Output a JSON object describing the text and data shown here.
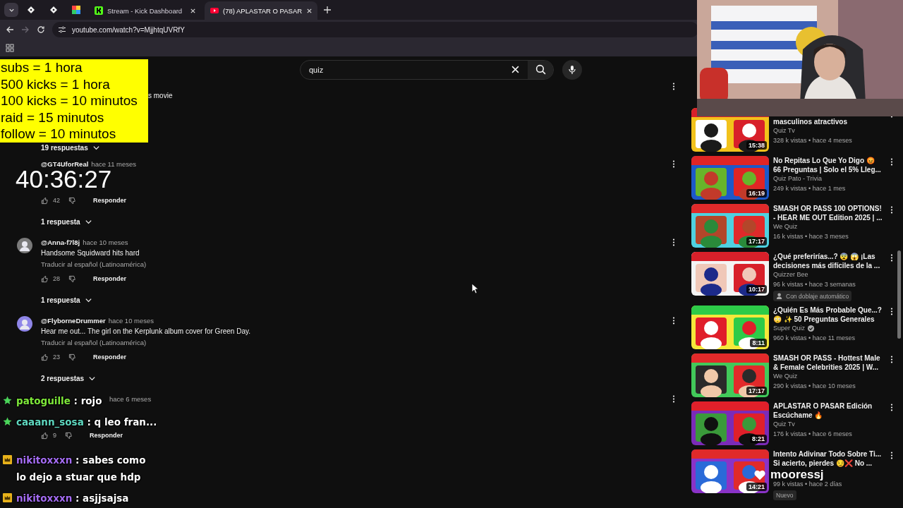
{
  "browser": {
    "tabs": [
      {
        "label": "Stream - Kick Dashboard",
        "kind": "kick",
        "selected": false
      },
      {
        "label": "(78) APLASTAR O PASAR",
        "kind": "youtube",
        "selected": true
      }
    ],
    "address": "youtube.com/watch?v=MjjhtqUVRfY"
  },
  "search": {
    "value": "quiz"
  },
  "comments": [
    {
      "kind": "partial",
      "text": "s movie",
      "replies": "19 respuestas"
    },
    {
      "kind": "full",
      "author": "@GT4UforReal",
      "time": "hace 11 meses",
      "avatar": false,
      "likes": "42",
      "reply": "Responder",
      "replies": "1 respuesta"
    },
    {
      "kind": "full",
      "author": "@Anna-f7l8j",
      "time": "hace 10 meses",
      "avatar": true,
      "text": "Handsome Squidward hits hard",
      "translate": "Traducir al español (Latinoamérica)",
      "likes": "28",
      "reply": "Responder",
      "replies": "1 respuesta"
    },
    {
      "kind": "full",
      "author": "@FlyborneDrummer",
      "time": "hace 10 meses",
      "avatar": true,
      "text": "Hear me out... The girl on the Kerplunk album cover for Green Day.",
      "translate": "Traducir al español (Latinoamérica)",
      "likes": "23",
      "reply": "Responder",
      "replies": "2 respuestas"
    },
    {
      "kind": "full",
      "time": "hace 6 meses",
      "avatar": false,
      "likes": "9",
      "reply": "Responder"
    }
  ],
  "sidebar": [
    {
      "kind": "partial",
      "title": "masculinos atractivos",
      "channel": "Quiz Tv",
      "meta": "328 k vistas • hace 4 meses",
      "duration": "15:38"
    },
    {
      "kind": "full",
      "title": "No Repitas Lo Que Yo Digo 😡 66 Preguntas | Solo el 5% Lleg...",
      "channel": "Quiz Pato - Trivia",
      "meta": "249 k vistas • hace 1 mes",
      "duration": "16:19"
    },
    {
      "kind": "full",
      "title": "SMASH OR PASS 100 OPTIONS! - HEAR ME OUT Edition 2025 | ...",
      "channel": "We Quiz",
      "meta": "16 k vistas • hace 3 meses",
      "duration": "17:17"
    },
    {
      "kind": "full",
      "title": "¿Qué preferirías...? 😨 😱 ¡Las decisiones más difíciles de la ...",
      "channel": "Quizzer Bee",
      "meta": "96 k vistas • hace 3 semanas",
      "duration": "10:17",
      "badge": {
        "kind": "dubbed",
        "text": "Con doblaje automático"
      }
    },
    {
      "kind": "full",
      "title": "¿Quién Es Más Probable Que...? 😳 ✨ 50 Preguntas Generales",
      "channel": "Super Quiz",
      "verified": true,
      "meta": "960 k vistas • hace 11 meses",
      "duration": "8:11"
    },
    {
      "kind": "full",
      "title": "SMASH OR PASS - Hottest Male & Female Celebrities 2025 | W...",
      "channel": "We Quiz",
      "meta": "290 k vistas • hace 10 meses",
      "duration": "17:17"
    },
    {
      "kind": "full",
      "title": "APLASTAR O PASAR Edición Escúchame 🔥",
      "channel": "Quiz Tv",
      "meta": "176 k vistas • hace 6 meses",
      "duration": "8:21"
    },
    {
      "kind": "full",
      "title": "Intento Adivinar Todo Sobre Ti... Si acierto, pierdes 😏❌ No ...",
      "meta": "99 k vistas • hace 2 días",
      "duration": "14:21",
      "badge": {
        "kind": "plain",
        "text": "Nuevo"
      }
    }
  ],
  "overlay": {
    "goals": [
      "subs = 1 hora",
      "500 kicks = 1 hora",
      "100 kicks = 10 minutos",
      "raid = 15 minutos",
      "follow = 10 minutos"
    ],
    "timer": "40:36:27",
    "chat": [
      {
        "kind": "star",
        "user": "patoguille",
        "color": "#7ee83a",
        "message": ": rojo"
      },
      {
        "kind": "star",
        "user": "caaann_sosa",
        "color": "#5fd8c0",
        "message": ": q leo fran..."
      },
      {
        "kind": "crown",
        "user": "nikitoxxxn",
        "color": "#a46cf2",
        "message": ": sabes como lo dejo a stuar que hdp"
      },
      {
        "kind": "crown",
        "user": "nikitoxxxn",
        "color": "#a46cf2",
        "message": ": asjjsajsa"
      }
    ],
    "follower": "mooressj"
  }
}
